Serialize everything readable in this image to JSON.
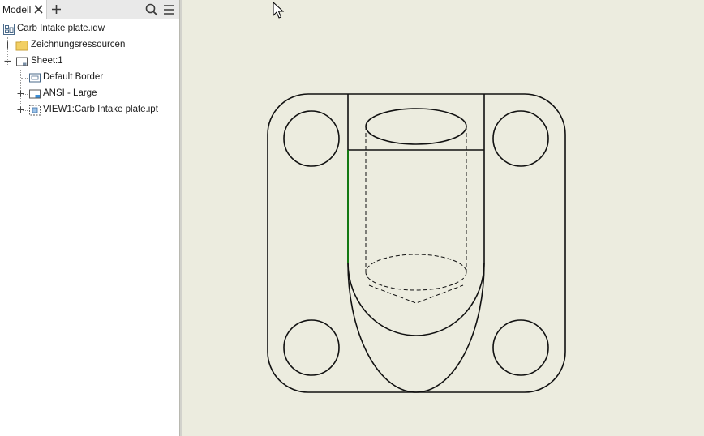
{
  "browser": {
    "tab_label": "Modell",
    "icons": {
      "close": "close-icon",
      "add": "plus-icon",
      "search": "search-icon",
      "menu": "hamburger-menu-icon"
    }
  },
  "tree": {
    "root": {
      "label": "Carb Intake plate.idw",
      "icon": "drawing-document-icon"
    },
    "items": [
      {
        "label": "Zeichnungsressourcen",
        "icon": "folder-icon",
        "expander": "+"
      },
      {
        "label": "Sheet:1",
        "icon": "sheet-icon",
        "expander": "-"
      },
      {
        "label": "Default Border",
        "icon": "border-icon"
      },
      {
        "label": "ANSI - Large",
        "icon": "title-block-icon",
        "expander": "+"
      },
      {
        "label": "VIEW1:Carb Intake plate.ipt",
        "icon": "drawing-view-icon",
        "expander": "+"
      }
    ]
  },
  "colors": {
    "canvas_background": "#ececdf",
    "line": "#111111",
    "highlight_edge": "#0a7a0a"
  }
}
